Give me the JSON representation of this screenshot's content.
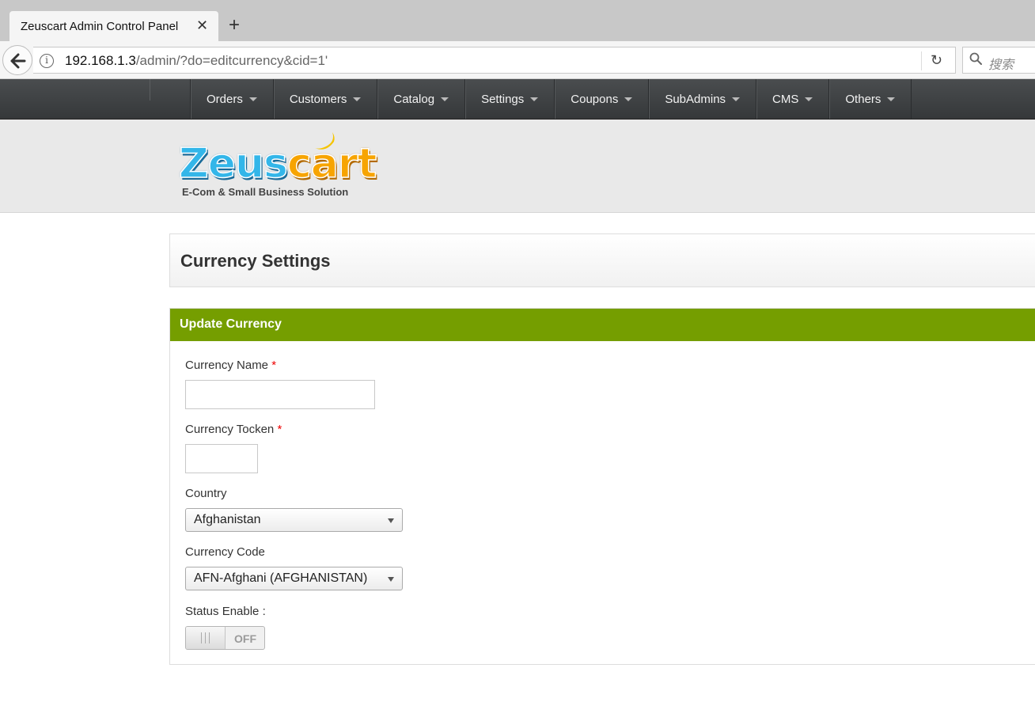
{
  "browser": {
    "tab_title": "Zeuscart Admin Control Panel",
    "tab_close": "✕",
    "new_tab": "+",
    "url_host": "192.168.1.3",
    "url_path": "/admin/?do=editcurrency&cid=1'",
    "search_placeholder": "搜索"
  },
  "nav": {
    "items": [
      {
        "label": "Orders"
      },
      {
        "label": "Customers"
      },
      {
        "label": "Catalog"
      },
      {
        "label": "Settings"
      },
      {
        "label": "Coupons"
      },
      {
        "label": "SubAdmins"
      },
      {
        "label": "CMS"
      },
      {
        "label": "Others"
      }
    ]
  },
  "logo": {
    "word_part1": "Zeus",
    "word_part2": "cart",
    "tagline": "E-Com & Small Business Solution",
    "colors": {
      "blue": "#33b6e9",
      "orange": "#f7a400",
      "moon": "#f5c400"
    }
  },
  "page": {
    "title": "Currency Settings"
  },
  "form": {
    "panel_title": "Update Currency",
    "panel_color": "#759e00",
    "required_mark": "*",
    "currency_name_label": "Currency Name",
    "currency_name_value": "",
    "currency_token_label": "Currency Tocken",
    "currency_token_value": "",
    "country_label": "Country",
    "country_value": "Afghanistan",
    "currency_code_label": "Currency Code",
    "currency_code_value": "AFN-Afghani (AFGHANISTAN)",
    "status_label": "Status Enable :",
    "status_toggle_text": "OFF"
  }
}
